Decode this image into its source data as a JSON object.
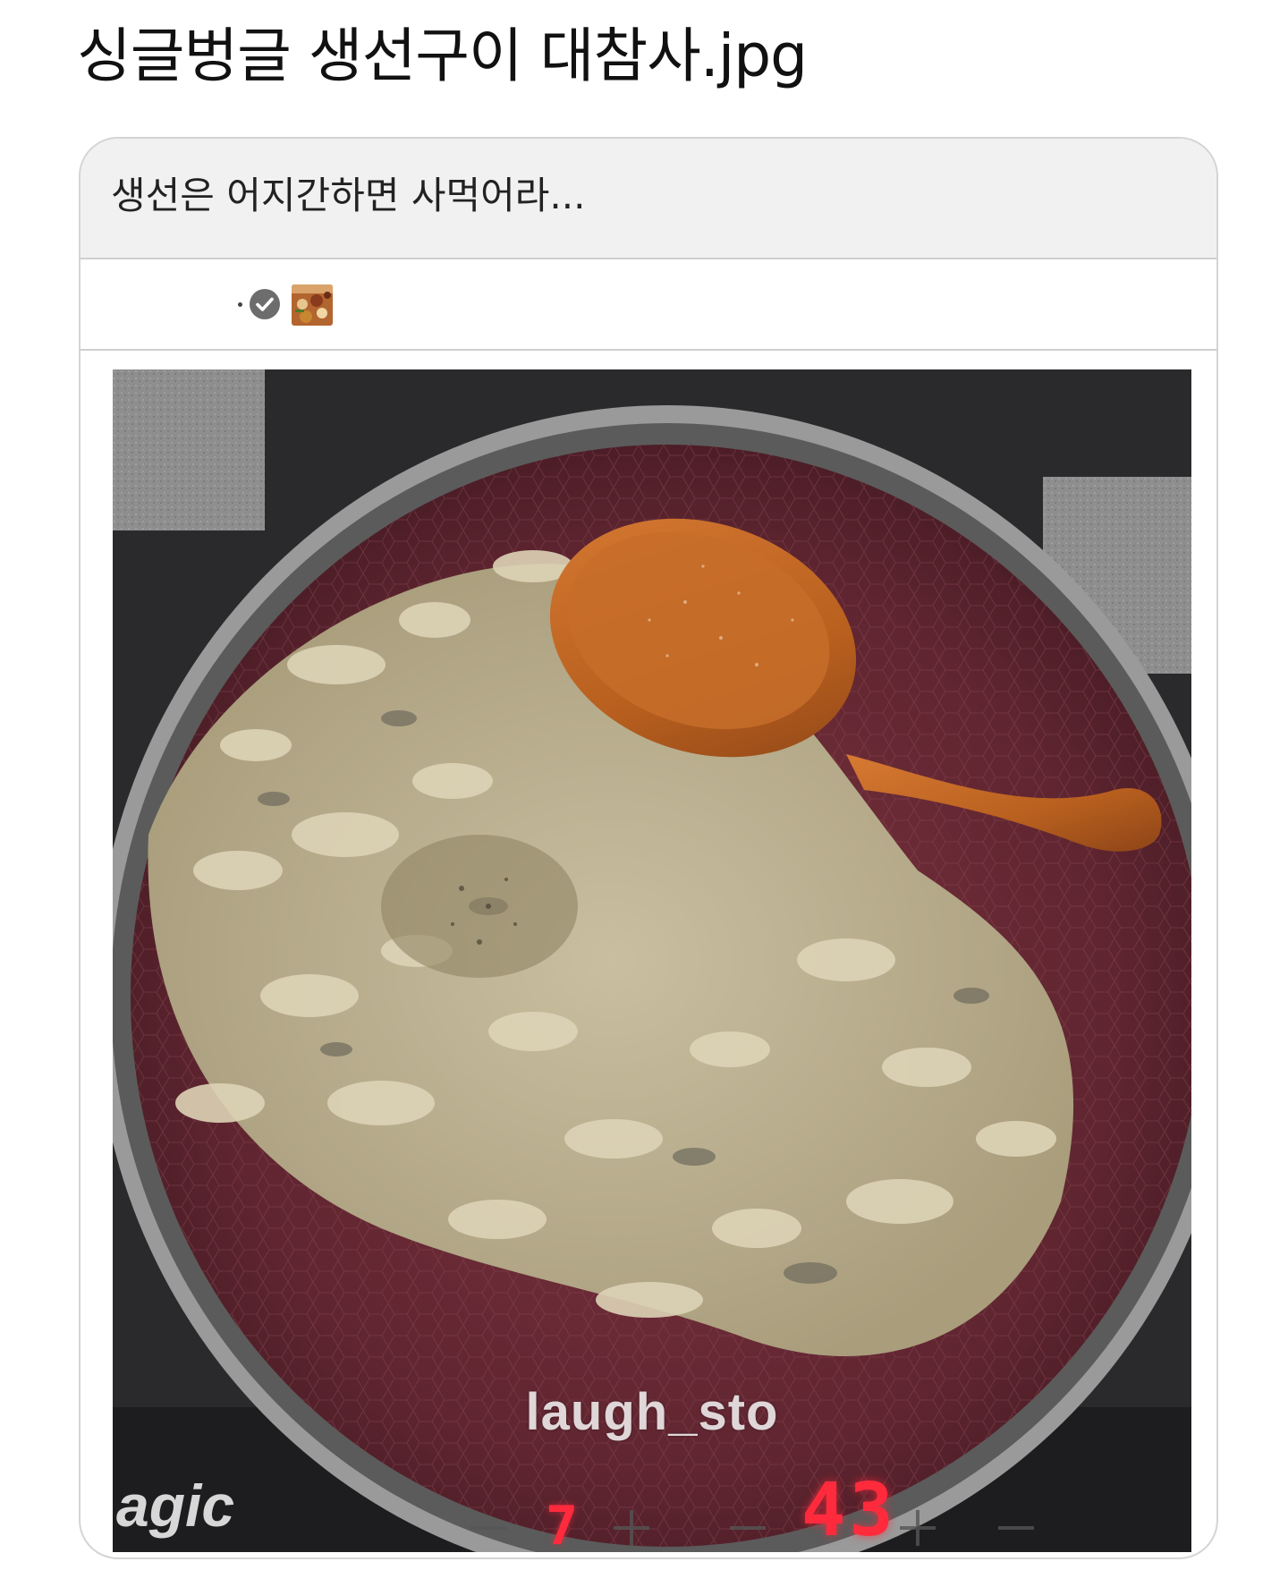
{
  "page": {
    "title": "싱글벙글 생선구이 대참사.jpg"
  },
  "post": {
    "caption": "생선은 어지간하면 사먹어라...",
    "author": {
      "separator": "·",
      "verified_icon": "check-circle-icon",
      "avatar_icon": "food-thumbnail-icon"
    },
    "photo": {
      "subject": "frying-pan-with-crumbled-fish-and-wooden-spoon",
      "watermark": "laugh_sto",
      "brand_text": "agic",
      "stove_display_right": "43",
      "stove_display_left": "7"
    }
  },
  "colors": {
    "card_border": "#d4d4d4",
    "header_bg": "#f1f1f1",
    "pan_surface": "#6b2b36",
    "spoon": "#c4702e",
    "stove_led": "#ff2b3d"
  }
}
